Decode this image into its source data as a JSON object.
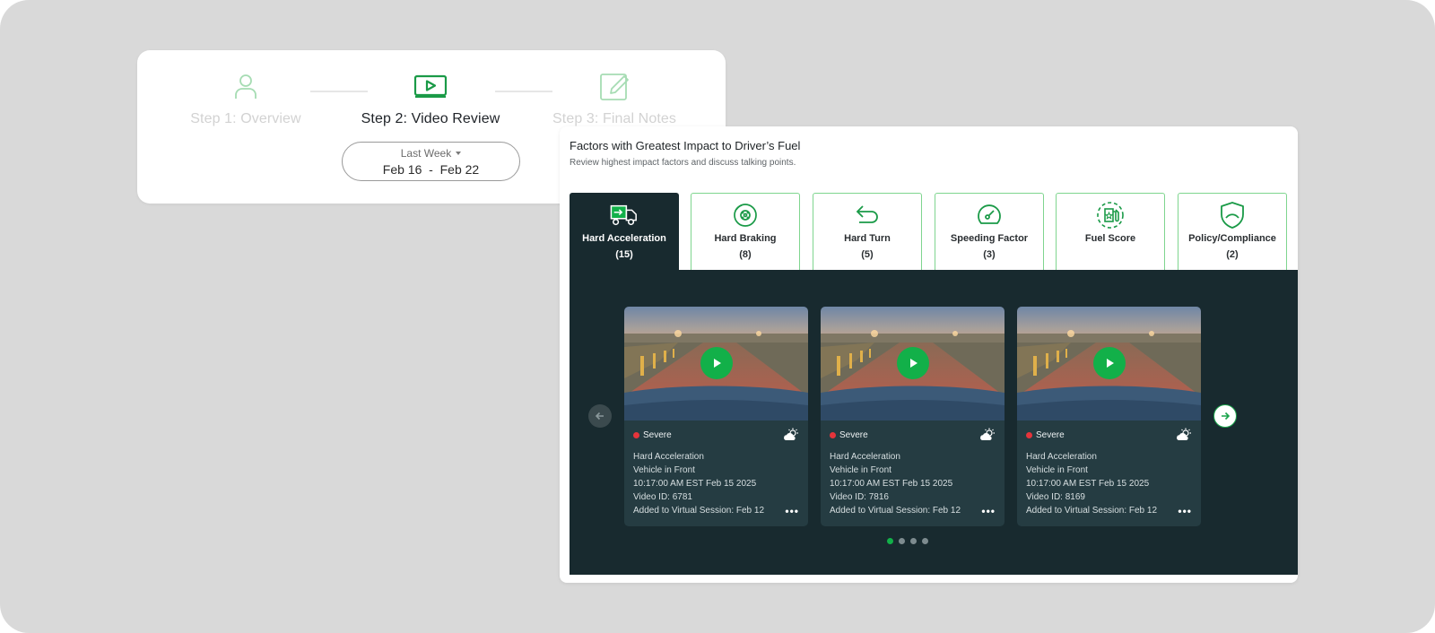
{
  "stepper": {
    "steps": [
      {
        "label": "Step 1: Overview",
        "icon": "user-icon",
        "state": "inactive"
      },
      {
        "label": "Step 2: Video Review",
        "icon": "video-play-icon",
        "state": "active"
      },
      {
        "label": "Step 3: Final Notes",
        "icon": "edit-note-icon",
        "state": "inactive"
      }
    ],
    "date_filter": {
      "period": "Last Week",
      "start": "Feb 16",
      "separator": "-",
      "end": "Feb 22"
    }
  },
  "factors": {
    "title": "Factors with Greatest Impact to Driver’s Fuel",
    "subtitle": "Review highest impact factors and discuss talking points.",
    "tabs": [
      {
        "label": "Hard Acceleration",
        "count": "(15)",
        "icon": "truck-icon",
        "active": true
      },
      {
        "label": "Hard Braking",
        "count": "(8)",
        "icon": "brake-disc-icon",
        "active": false
      },
      {
        "label": "Hard Turn",
        "count": "(5)",
        "icon": "turn-arrow-icon",
        "active": false
      },
      {
        "label": "Speeding Factor",
        "count": "(3)",
        "icon": "speedometer-icon",
        "active": false
      },
      {
        "label": "Fuel Score",
        "count": "",
        "icon": "fuel-pump-icon",
        "active": false
      },
      {
        "label": "Policy/Compliance",
        "count": "(2)",
        "icon": "shield-icon",
        "active": false
      }
    ],
    "videos": [
      {
        "severity": "Severe",
        "event": "Hard Acceleration",
        "detail": "Vehicle in Front",
        "time": "10:17:00 AM EST Feb 15 2025",
        "video_id": "Video ID: 6781",
        "added": "Added to Virtual Session: Feb 12",
        "more": "•••"
      },
      {
        "severity": "Severe",
        "event": "Hard Acceleration",
        "detail": "Vehicle in Front",
        "time": "10:17:00 AM EST Feb 15 2025",
        "video_id": "Video ID: 7816",
        "added": "Added to Virtual Session: Feb 12",
        "more": "•••"
      },
      {
        "severity": "Severe",
        "event": "Hard Acceleration",
        "detail": "Vehicle in Front",
        "time": "10:17:00 AM EST Feb 15 2025",
        "video_id": "Video ID: 8169",
        "added": "Added to Virtual Session: Feb 12",
        "more": "•••"
      }
    ],
    "carousel": {
      "pages": 4,
      "current": 1
    }
  },
  "colors": {
    "accent": "#12b049",
    "panel": "#182a2f",
    "card": "#253c42",
    "severe": "#e5343b"
  }
}
